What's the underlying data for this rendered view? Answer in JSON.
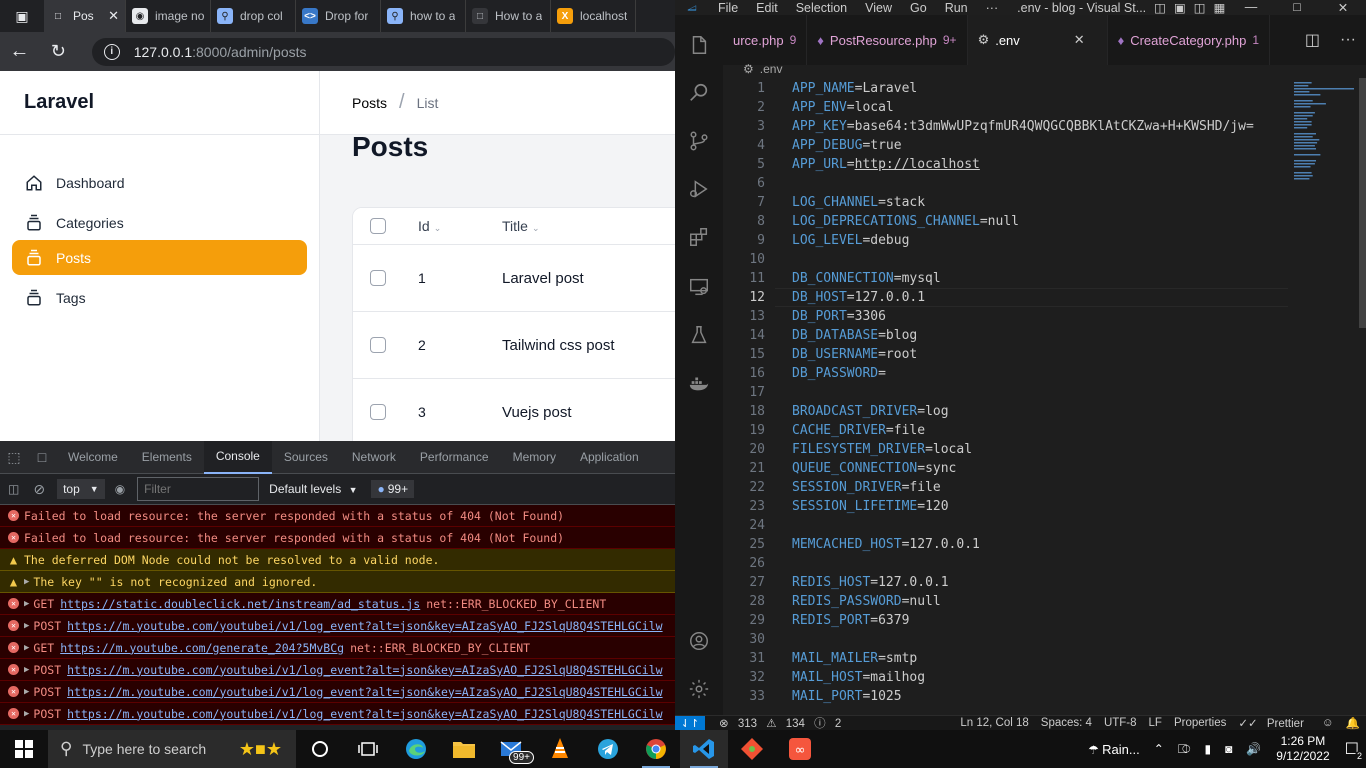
{
  "chrome": {
    "tabs": [
      {
        "title": "Pos",
        "active": true
      },
      {
        "title": "image no"
      },
      {
        "title": "drop col"
      },
      {
        "title": "Drop for"
      },
      {
        "title": "how to a"
      },
      {
        "title": "How to a"
      },
      {
        "title": "localhost"
      }
    ],
    "url_host": "127.0.0.1",
    "url_path": ":8000/admin/posts"
  },
  "admin": {
    "brand": "Laravel",
    "nav": [
      "Dashboard",
      "Categories",
      "Posts",
      "Tags"
    ],
    "breadcrumb": [
      "Posts",
      "List"
    ],
    "heading": "Posts",
    "columns": [
      "Id",
      "Title"
    ],
    "rows": [
      {
        "id": "1",
        "title": "Laravel post"
      },
      {
        "id": "2",
        "title": "Tailwind css post"
      },
      {
        "id": "3",
        "title": "Vuejs post"
      }
    ],
    "accent": "#f59e0b"
  },
  "devtools": {
    "tabs": [
      "Welcome",
      "Elements",
      "Console",
      "Sources",
      "Network",
      "Performance",
      "Memory",
      "Application"
    ],
    "active_tab": "Console",
    "context": "top",
    "filter_placeholder": "Filter",
    "levels": "Default levels",
    "issues_count": "99+",
    "messages": [
      {
        "kind": "err",
        "prefix": "",
        "link": "",
        "text": "Failed to load resource: the server responded with a status of 404 (Not Found)"
      },
      {
        "kind": "err",
        "prefix": "",
        "link": "",
        "text": "Failed to load resource: the server responded with a status of 404 (Not Found)"
      },
      {
        "kind": "warn",
        "prefix": "",
        "link": "",
        "text": "The deferred DOM Node could not be resolved to a valid node."
      },
      {
        "kind": "warn",
        "prefix": "",
        "link": "",
        "text": "The key \"\" is not recognized and ignored."
      },
      {
        "kind": "err",
        "prefix": "GET",
        "link": "https://static.doubleclick.net/instream/ad_status.js",
        "text": "net::ERR_BLOCKED_BY_CLIENT"
      },
      {
        "kind": "err",
        "prefix": "POST",
        "link": "https://m.youtube.com/youtubei/v1/log_event?alt=json&key=AIzaSyAO_FJ2SlqU8Q4STEHLGCilw",
        "text": ""
      },
      {
        "kind": "err",
        "prefix": "GET",
        "link": "https://m.youtube.com/generate_204?5MvBCg",
        "text": "net::ERR_BLOCKED_BY_CLIENT"
      },
      {
        "kind": "err",
        "prefix": "POST",
        "link": "https://m.youtube.com/youtubei/v1/log_event?alt=json&key=AIzaSyAO_FJ2SlqU8Q4STEHLGCilw",
        "text": ""
      },
      {
        "kind": "err",
        "prefix": "POST",
        "link": "https://m.youtube.com/youtubei/v1/log_event?alt=json&key=AIzaSyAO_FJ2SlqU8Q4STEHLGCilw",
        "text": ""
      },
      {
        "kind": "err",
        "prefix": "POST",
        "link": "https://m.youtube.com/youtubei/v1/log_event?alt=json&key=AIzaSyAO_FJ2SlqU8Q4STEHLGCilw",
        "text": ""
      }
    ]
  },
  "vscode": {
    "menu": [
      "File",
      "Edit",
      "Selection",
      "View",
      "Go",
      "Run",
      "···"
    ],
    "window_title": ".env - blog - Visual St...",
    "tabs": [
      {
        "name": "urce.php",
        "badge": "9"
      },
      {
        "name": "PostResource.php",
        "badge": "9+"
      },
      {
        "name": ".env",
        "badge": "",
        "active": true
      },
      {
        "name": "CreateCategory.php",
        "badge": "1"
      }
    ],
    "breadcrumb": ".env",
    "current_line": 12,
    "lines": [
      [
        "APP_NAME",
        "Laravel"
      ],
      [
        "APP_ENV",
        "local"
      ],
      [
        "APP_KEY",
        "base64:t3dmWwUPzqfmUR4QWQGCQBBKlAtCKZwa+H+KWSHD/jw="
      ],
      [
        "APP_DEBUG",
        "true"
      ],
      [
        "APP_URL",
        "http://localhost"
      ],
      [
        "",
        ""
      ],
      [
        "LOG_CHANNEL",
        "stack"
      ],
      [
        "LOG_DEPRECATIONS_CHANNEL",
        "null"
      ],
      [
        "LOG_LEVEL",
        "debug"
      ],
      [
        "",
        ""
      ],
      [
        "DB_CONNECTION",
        "mysql"
      ],
      [
        "DB_HOST",
        "127.0.0.1"
      ],
      [
        "DB_PORT",
        "3306"
      ],
      [
        "DB_DATABASE",
        "blog"
      ],
      [
        "DB_USERNAME",
        "root"
      ],
      [
        "DB_PASSWORD",
        ""
      ],
      [
        "",
        ""
      ],
      [
        "BROADCAST_DRIVER",
        "log"
      ],
      [
        "CACHE_DRIVER",
        "file"
      ],
      [
        "FILESYSTEM_DRIVER",
        "local"
      ],
      [
        "QUEUE_CONNECTION",
        "sync"
      ],
      [
        "SESSION_DRIVER",
        "file"
      ],
      [
        "SESSION_LIFETIME",
        "120"
      ],
      [
        "",
        ""
      ],
      [
        "MEMCACHED_HOST",
        "127.0.0.1"
      ],
      [
        "",
        ""
      ],
      [
        "REDIS_HOST",
        "127.0.0.1"
      ],
      [
        "REDIS_PASSWORD",
        "null"
      ],
      [
        "REDIS_PORT",
        "6379"
      ],
      [
        "",
        ""
      ],
      [
        "MAIL_MAILER",
        "smtp"
      ],
      [
        "MAIL_HOST",
        "mailhog"
      ],
      [
        "MAIL_PORT",
        "1025"
      ]
    ],
    "status": {
      "errors": "313",
      "warnings": "134",
      "info": "2",
      "position": "Ln 12, Col 18",
      "spaces": "Spaces: 4",
      "encoding": "UTF-8",
      "eol": "LF",
      "language": "Properties",
      "formatter": "Prettier"
    }
  },
  "taskbar": {
    "search_placeholder": "Type here to search",
    "mail_badge": "99+",
    "weather": "Rain...",
    "time": "1:26 PM",
    "date": "9/12/2022",
    "notifications": "2"
  }
}
